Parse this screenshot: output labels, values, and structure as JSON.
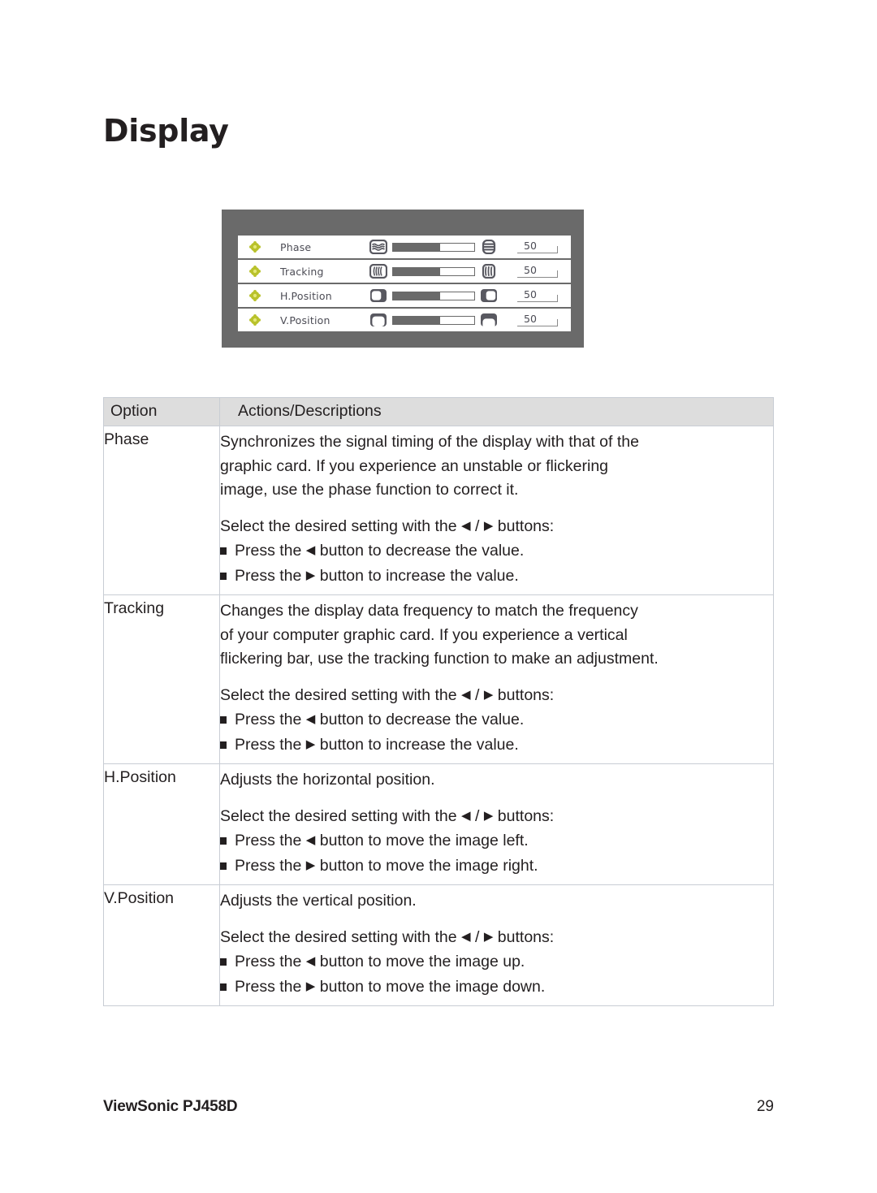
{
  "page": {
    "title": "Display"
  },
  "osd": {
    "frame_color": "#6a6a6a",
    "bullet_color": "#b9c22c",
    "rows": [
      {
        "bullet_icon": "diamond-bullet-icon",
        "label": "Phase",
        "left_icon": "phase-wave-icon",
        "right_icon": "phase-stack-icon",
        "value": "50",
        "fill_percent": 58
      },
      {
        "bullet_icon": "diamond-bullet-icon",
        "label": "Tracking",
        "left_icon": "tracking-narrow-icon",
        "right_icon": "tracking-wide-icon",
        "value": "50",
        "fill_percent": 58
      },
      {
        "bullet_icon": "diamond-bullet-icon",
        "label": "H.Position",
        "left_icon": "h-position-left-icon",
        "right_icon": "h-position-right-icon",
        "value": "50",
        "fill_percent": 58
      },
      {
        "bullet_icon": "diamond-bullet-icon",
        "label": "V.Position",
        "left_icon": "v-position-down-icon",
        "right_icon": "v-position-up-icon",
        "value": "50",
        "fill_percent": 58
      }
    ]
  },
  "table": {
    "headers": {
      "option": "Option",
      "actions": "Actions/Descriptions"
    },
    "rows": [
      {
        "option": "Phase",
        "desc": [
          "Synchronizes the signal timing of the display with that of the",
          "graphic card. If you experience an unstable or flickering",
          "image, use the phase function to correct it."
        ],
        "select_line_pre": "Select the desired setting with the ",
        "select_line_arrow_left": "◀",
        "select_line_sep": " / ",
        "select_line_arrow_right": "▶",
        "select_line_post": " buttons:",
        "bullets": [
          {
            "pre": "Press the ",
            "arrow": "◀",
            "post": " button to decrease the value."
          },
          {
            "pre": "Press the ",
            "arrow": "▶",
            "post": " button to increase the value."
          }
        ]
      },
      {
        "option": "Tracking",
        "desc": [
          "Changes the display data frequency to match the frequency",
          "of your computer graphic card. If you experience a vertical",
          "flickering bar, use the tracking function to make an adjustment."
        ],
        "select_line_pre": "Select the desired setting with the ",
        "select_line_arrow_left": "◀",
        "select_line_sep": " / ",
        "select_line_arrow_right": "▶",
        "select_line_post": " buttons:",
        "bullets": [
          {
            "pre": "Press the ",
            "arrow": "◀",
            "post": " button to decrease the value."
          },
          {
            "pre": "Press the ",
            "arrow": "▶",
            "post": " button to increase the value."
          }
        ]
      },
      {
        "option": "H.Position",
        "desc": [
          "Adjusts the horizontal position."
        ],
        "select_line_pre": "Select the desired setting with the ",
        "select_line_arrow_left": "◀",
        "select_line_sep": " / ",
        "select_line_arrow_right": "▶",
        "select_line_post": " buttons:",
        "bullets": [
          {
            "pre": "Press the ",
            "arrow": "◀",
            "post": " button to move the image left."
          },
          {
            "pre": "Press the ",
            "arrow": "▶",
            "post": " button to move the image right."
          }
        ]
      },
      {
        "option": "V.Position",
        "desc": [
          "Adjusts the vertical position."
        ],
        "select_line_pre": "Select the desired setting with the ",
        "select_line_arrow_left": "◀",
        "select_line_sep": " / ",
        "select_line_arrow_right": "▶",
        "select_line_post": " buttons:",
        "bullets": [
          {
            "pre": "Press the ",
            "arrow": "◀",
            "post": " button to move the image up."
          },
          {
            "pre": "Press the ",
            "arrow": "▶",
            "post": " button to move the image down."
          }
        ]
      }
    ]
  },
  "footer": {
    "model": "ViewSonic PJ458D",
    "page_number": "29"
  }
}
